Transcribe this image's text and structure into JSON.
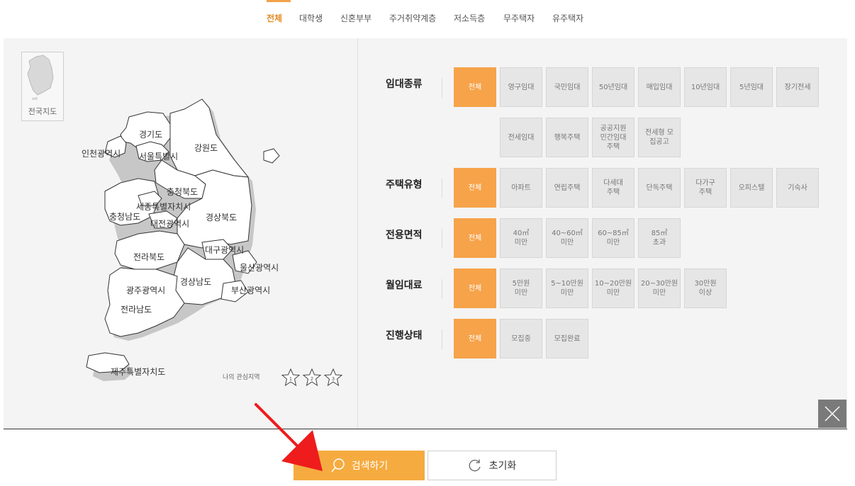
{
  "tabs": [
    "전체",
    "대학생",
    "신혼부부",
    "주거취약계층",
    "저소득층",
    "무주택자",
    "유주택자"
  ],
  "map": {
    "mini_map_label": "전국지도",
    "regions": {
      "gyeonggi": "경기도",
      "incheon": "인천광역시",
      "seoul": "서울특별시",
      "gangwon": "강원도",
      "chungbuk": "충청북도",
      "sejong": "세종특별자치시",
      "chungnam": "충청남도",
      "daejeon": "대전광역시",
      "gyeongbuk": "경상북도",
      "daegu": "대구광역시",
      "jeonbuk": "전라북도",
      "ulsan": "울산광역시",
      "gyeongnam": "경상남도",
      "gwangju": "광주광역시",
      "busan": "부산광역시",
      "jeonnam": "전라남도",
      "jeju": "제주특별자치도"
    },
    "favorites_label": "나의 관심지역",
    "favorite_slots": [
      "1",
      "2",
      "3"
    ]
  },
  "filters": {
    "rental_type": {
      "label": "임대종류",
      "options": [
        "전체",
        "영구임대",
        "국민임대",
        "50년임대",
        "매입임대",
        "10년임대",
        "5년임대",
        "장기전세",
        "전세임대",
        "행복주택",
        "공공지원\n민간임대\n주택",
        "전세형 모\n집공고"
      ]
    },
    "housing_type": {
      "label": "주택유형",
      "options": [
        "전체",
        "아파트",
        "연립주택",
        "다세대\n주택",
        "단독주택",
        "다가구\n주택",
        "오피스텔",
        "기숙사"
      ]
    },
    "area": {
      "label": "전용면적",
      "options": [
        "전체",
        "40㎡\n미만",
        "40~60㎡\n미만",
        "60~85㎡\n미만",
        "85㎡\n초과"
      ]
    },
    "monthly_rent": {
      "label": "월임대료",
      "options": [
        "전체",
        "5만원\n미만",
        "5~10만원\n미만",
        "10~20만원\n미만",
        "20~30만원\n미만",
        "30만원\n이상"
      ]
    },
    "status": {
      "label": "진행상태",
      "options": [
        "전체",
        "모집중",
        "모집완료"
      ]
    }
  },
  "buttons": {
    "search": "검색하기",
    "reset": "초기화"
  },
  "colors": {
    "accent": "#f6a34a",
    "search_button": "#f5ab40",
    "arrow": "#ee1c1c"
  }
}
